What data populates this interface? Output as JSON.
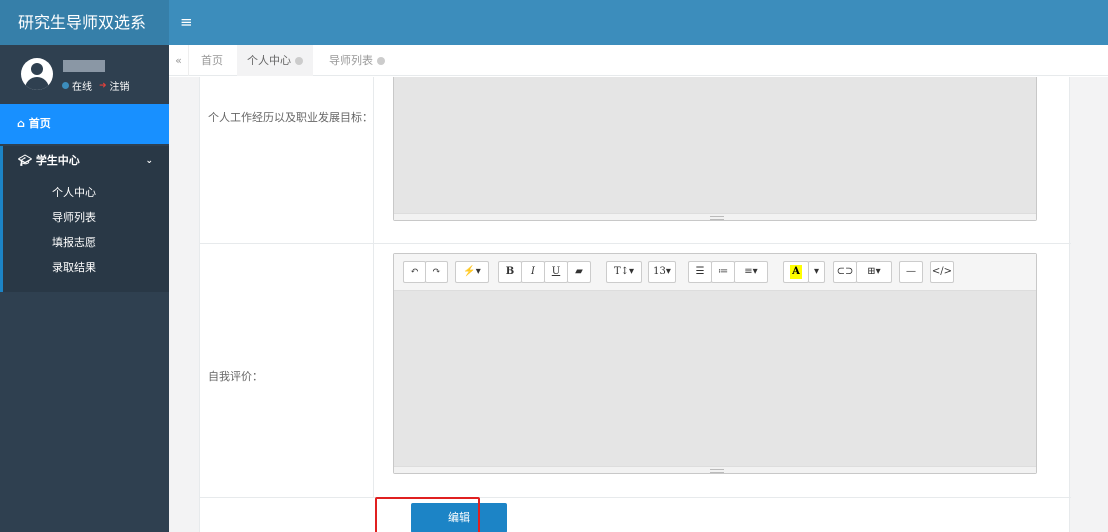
{
  "brand": {
    "title": "研究生导师双选系"
  },
  "user": {
    "status": "在线",
    "logout": "注销"
  },
  "sidebar": {
    "home": "首页",
    "group": "学生中心",
    "items": [
      "个人中心",
      "导师列表",
      "填报志愿",
      "录取结果"
    ]
  },
  "tabs": [
    "首页",
    "个人中心",
    "导师列表"
  ],
  "form": {
    "field1_label": "个人工作经历以及职业发展目标：",
    "field2_label": "自我评价：",
    "edit_button": "编辑"
  },
  "toolbar": {
    "font_size": "13",
    "buttons": [
      "undo-icon",
      "redo-icon",
      "magic-wand-icon",
      "bold-icon",
      "italic-icon",
      "underline-icon",
      "eraser-icon",
      "text-height-icon",
      "font-size-select",
      "unordered-list-icon",
      "ordered-list-icon",
      "align-icon",
      "highlight-color-icon",
      "color-dropdown-icon",
      "link-icon",
      "table-icon",
      "horizontal-rule-icon",
      "code-view-icon"
    ]
  },
  "colors": {
    "sidebar": "#2f4050",
    "topbar": "#3c8dbc",
    "accent": "#1c84c6",
    "active_nav": "#1890ff",
    "highlight_box": "#e02020"
  }
}
